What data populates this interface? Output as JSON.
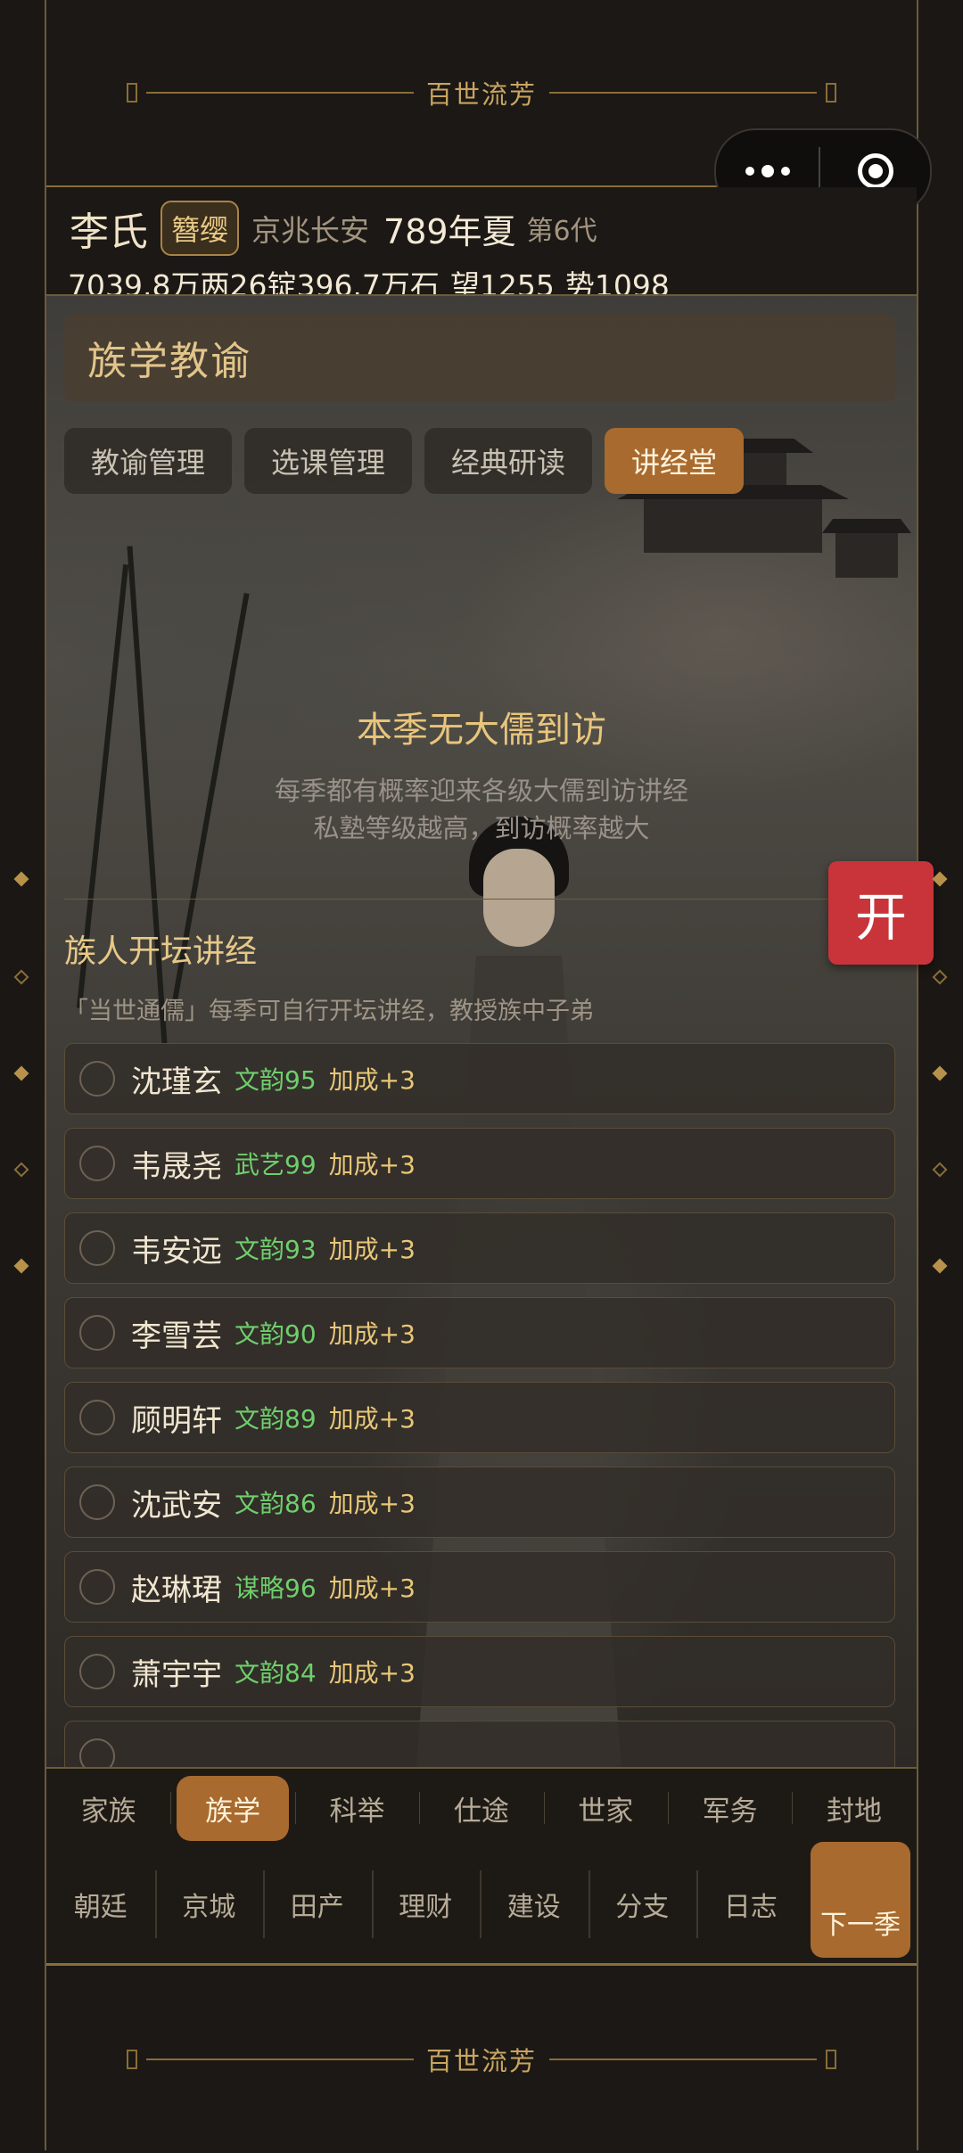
{
  "banner": {
    "title": "百世流芳"
  },
  "status": {
    "clan_name": "李氏",
    "rank": "簪缨",
    "location": "京兆长安",
    "year": "789年夏",
    "generation": "第6代",
    "wealth": "7039.8万两26锭396.7万石",
    "prestige": "望1255",
    "power": "势1098"
  },
  "panel": {
    "title": "族学教谕",
    "tabs": [
      "教谕管理",
      "选课管理",
      "经典研读",
      "讲经堂"
    ],
    "active_tab": "讲经堂"
  },
  "visit": {
    "title": "本季无大儒到访",
    "desc_line1": "每季都有概率迎来各级大儒到访讲经",
    "desc_line2": "私塾等级越高，到访概率越大"
  },
  "lecture": {
    "title": "族人开坛讲经",
    "desc": "「当世通儒」每季可自行开坛讲经，教授族中子弟",
    "members": [
      {
        "name": "沈瑾玄",
        "attr": "文韵95",
        "bonus": "加成+3"
      },
      {
        "name": "韦晟尧",
        "attr": "武艺99",
        "bonus": "加成+3"
      },
      {
        "name": "韦安远",
        "attr": "文韵93",
        "bonus": "加成+3"
      },
      {
        "name": "李雪芸",
        "attr": "文韵90",
        "bonus": "加成+3"
      },
      {
        "name": "顾明轩",
        "attr": "文韵89",
        "bonus": "加成+3"
      },
      {
        "name": "沈武安",
        "attr": "文韵86",
        "bonus": "加成+3"
      },
      {
        "name": "赵琳珺",
        "attr": "谋略96",
        "bonus": "加成+3"
      },
      {
        "name": "萧宇宇",
        "attr": "文韵84",
        "bonus": "加成+3"
      }
    ]
  },
  "fab": {
    "label": "开"
  },
  "nav": {
    "row1": [
      "家族",
      "族学",
      "科举",
      "仕途",
      "世家",
      "军务",
      "封地"
    ],
    "row1_active": "族学",
    "row2": [
      "朝廷",
      "京城",
      "田产",
      "理财",
      "建设",
      "分支",
      "日志"
    ],
    "next_season": "下一季"
  },
  "colors": {
    "accent": "#a86a2e",
    "gold": "#c9a561",
    "green_attr": "#6fcf6d",
    "fab_red": "#c8343a"
  }
}
